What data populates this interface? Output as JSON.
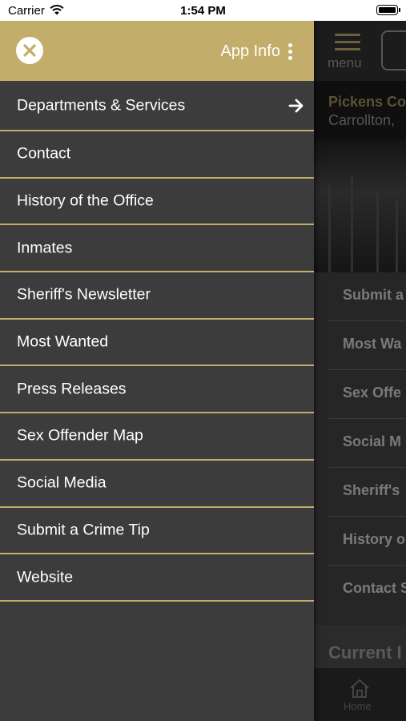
{
  "status_bar": {
    "carrier": "Carrier",
    "time": "1:54 PM"
  },
  "drawer": {
    "header": {
      "app_info_label": "App Info"
    },
    "items": [
      {
        "label": "Departments & Services",
        "has_arrow": true
      },
      {
        "label": "Contact"
      },
      {
        "label": "History of the Office"
      },
      {
        "label": "Inmates"
      },
      {
        "label": "Sheriff's Newsletter"
      },
      {
        "label": "Most Wanted"
      },
      {
        "label": "Press Releases"
      },
      {
        "label": "Sex Offender Map"
      },
      {
        "label": "Social Media"
      },
      {
        "label": "Submit a Crime Tip"
      },
      {
        "label": "Website"
      }
    ]
  },
  "background": {
    "menu_label": "menu",
    "title": "Pickens Co",
    "subtitle": "Carrollton,",
    "list_items": [
      "Submit a",
      "Most Wa",
      "Sex Offe",
      "Social M",
      "Sheriff's",
      "History o",
      "Contact S"
    ],
    "section_title": "Current I",
    "tab_home_label": "Home"
  },
  "colors": {
    "accent": "#c2ad6b",
    "drawer_bg": "#3c3c3c",
    "header_bg": "#1c1c1c"
  }
}
